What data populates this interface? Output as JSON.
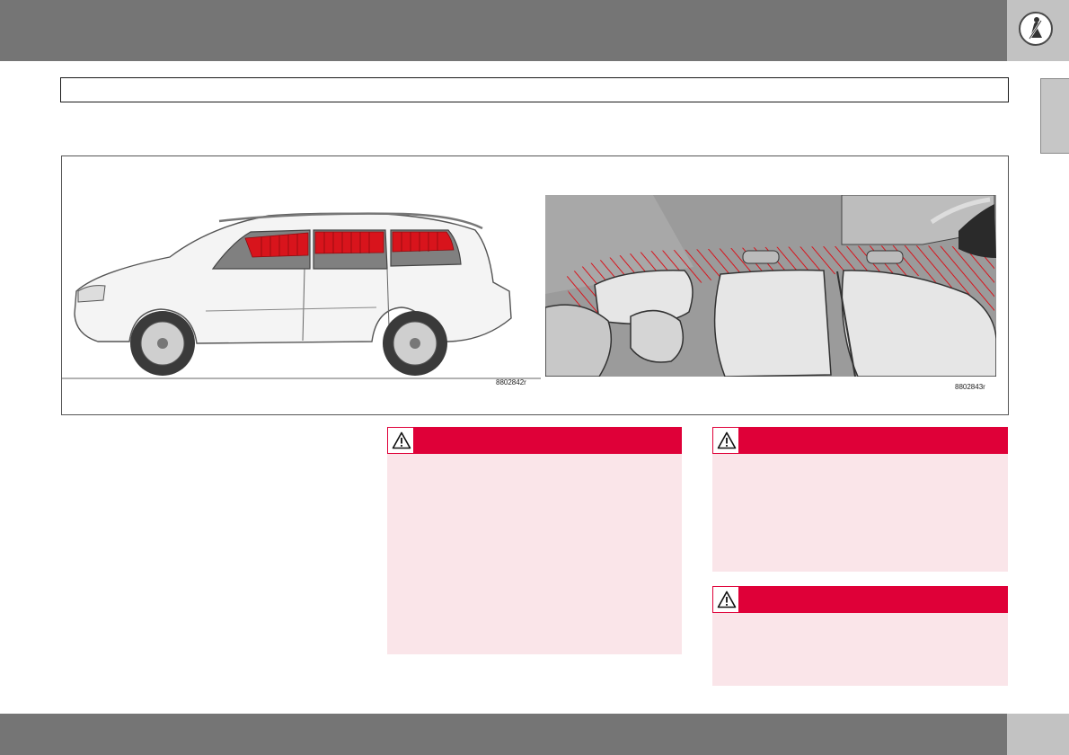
{
  "header": {
    "section_icon": "seatbelt-person-icon"
  },
  "title_box": {
    "text": ""
  },
  "figure": {
    "left_code": "8802842r",
    "right_code": "8802843r",
    "highlight_color": "#d8141c"
  },
  "warnings": [
    {
      "icon": "warning-triangle-icon",
      "text": ""
    },
    {
      "icon": "warning-triangle-icon",
      "text": ""
    },
    {
      "icon": "warning-triangle-icon",
      "text": ""
    }
  ],
  "colors": {
    "bar": "#757575",
    "corner": "#c2c2c2",
    "warning_header": "#df0038",
    "warning_body": "#fae5e9"
  }
}
